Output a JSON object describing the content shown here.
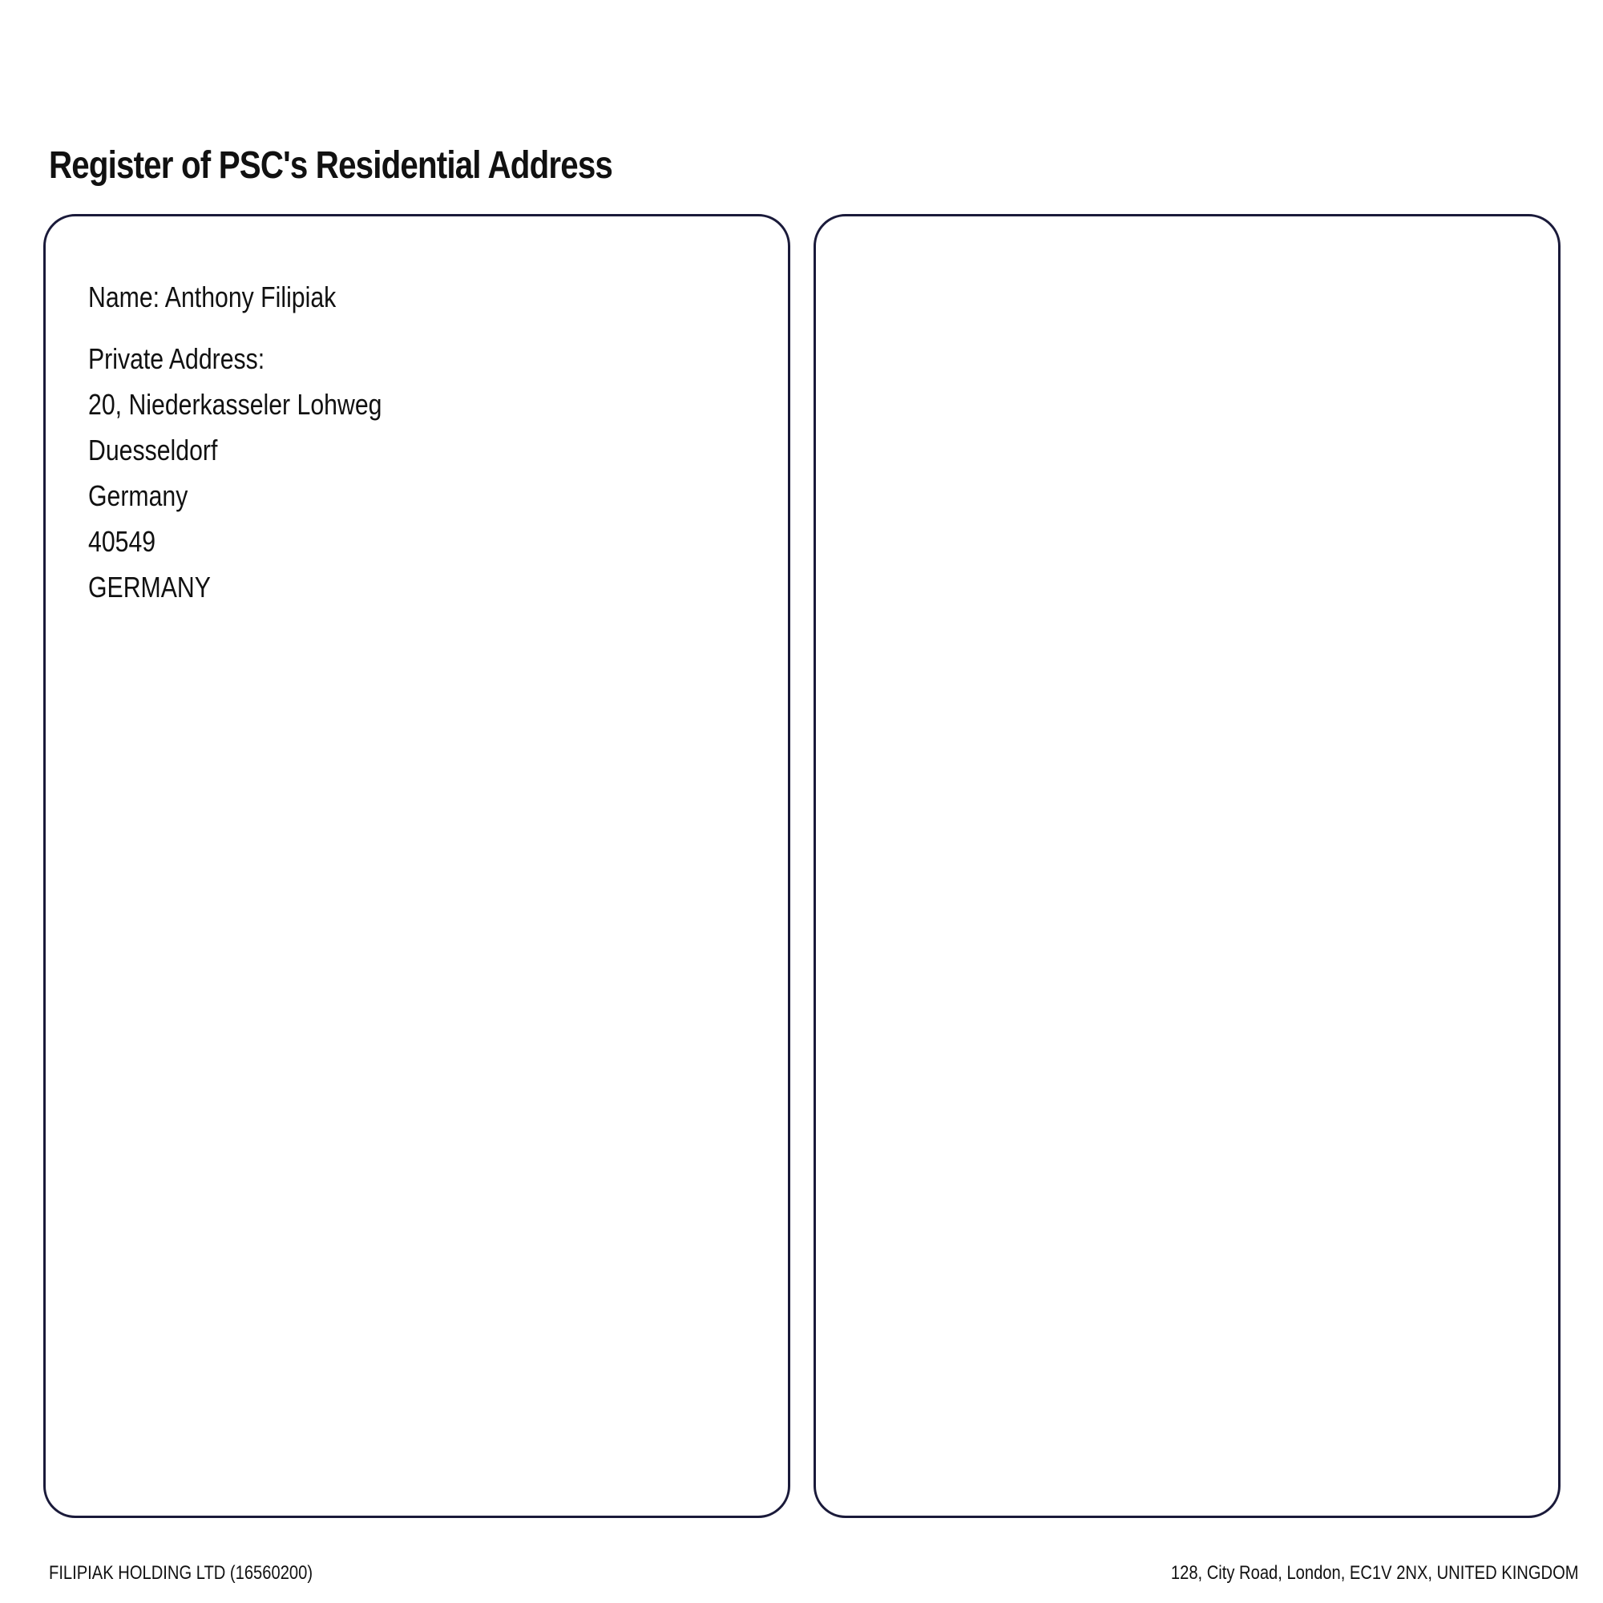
{
  "document": {
    "title": "Register of PSC's Residential Address"
  },
  "left_panel": {
    "name_line": "Name: Anthony Filipiak",
    "address_label": "Private Address:",
    "address_lines": [
      "20, Niederkasseler Lohweg",
      "Duesseldorf",
      "Germany",
      "40549",
      "GERMANY"
    ]
  },
  "footer": {
    "company": "FILIPIAK HOLDING LTD (16560200)",
    "address": "128, City Road, London, EC1V 2NX, UNITED KINGDOM"
  },
  "colors": {
    "panel_border": "#1a1a3a",
    "text": "#111111"
  }
}
